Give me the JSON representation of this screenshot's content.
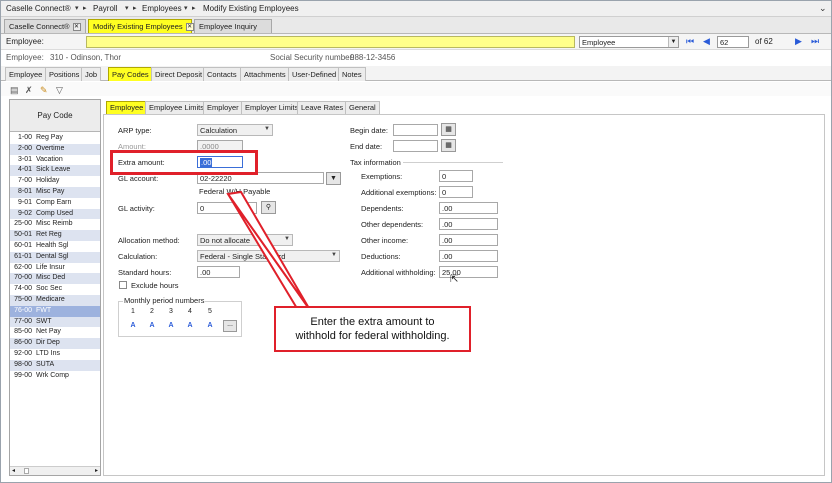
{
  "breadcrumb": [
    "Caselle Connect®",
    "Payroll",
    "Employees",
    "Modify Existing Employees"
  ],
  "doc_tabs": [
    {
      "label": "Caselle Connect®",
      "active": false
    },
    {
      "label": "Modify Existing Employees",
      "active": true
    },
    {
      "label": "Employee Inquiry",
      "active": false
    }
  ],
  "search": {
    "employee_label": "Employee:",
    "mode_value": "Employee",
    "record_number": "62",
    "record_total": "of 62"
  },
  "info": {
    "employee_label": "Employee:",
    "employee_value": "310 - Odinson, Thor",
    "ssn_label": "Social Security number:",
    "ssn_value": "988-12-3456"
  },
  "record_tabs": [
    "Employee",
    "Positions",
    "Job",
    "Pay Codes",
    "Direct Deposit",
    "Contacts",
    "Attachments",
    "User-Defined",
    "Notes"
  ],
  "pay_code_list": {
    "header": "Pay Code",
    "rows": [
      {
        "code": "1-00",
        "name": "Reg Pay"
      },
      {
        "code": "2-00",
        "name": "Overtime"
      },
      {
        "code": "3-01",
        "name": "Vacation"
      },
      {
        "code": "4-01",
        "name": "Sick Leave"
      },
      {
        "code": "7-00",
        "name": "Holiday"
      },
      {
        "code": "8-01",
        "name": "Misc Pay"
      },
      {
        "code": "9-01",
        "name": "Comp Earn"
      },
      {
        "code": "9-02",
        "name": "Comp Used"
      },
      {
        "code": "25-00",
        "name": "Misc Reimb"
      },
      {
        "code": "50-01",
        "name": "Ret Reg"
      },
      {
        "code": "60-01",
        "name": "Health Sgl"
      },
      {
        "code": "61-01",
        "name": "Dental Sgl"
      },
      {
        "code": "62-00",
        "name": "Life Insur"
      },
      {
        "code": "70-00",
        "name": "Misc Ded"
      },
      {
        "code": "74-00",
        "name": "Soc Sec"
      },
      {
        "code": "75-00",
        "name": "Medicare"
      },
      {
        "code": "76-00",
        "name": "FWT"
      },
      {
        "code": "77-00",
        "name": "SWT"
      },
      {
        "code": "85-00",
        "name": "Net Pay"
      },
      {
        "code": "86-00",
        "name": "Dir Dep"
      },
      {
        "code": "92-00",
        "name": "LTD Ins"
      },
      {
        "code": "98-00",
        "name": "SUTA"
      },
      {
        "code": "99-00",
        "name": "Wrk Comp"
      }
    ]
  },
  "form_tabs": [
    "Employee",
    "Employee Limits",
    "Employer",
    "Employer Limits",
    "Leave Rates",
    "General"
  ],
  "form": {
    "arp_type_label": "ARP type:",
    "arp_type_value": "Calculation",
    "amount_label": "Amount:",
    "amount_value": ".0000",
    "extra_amount_label": "Extra amount:",
    "extra_amount_value": ".00",
    "gl_account_label": "GL account:",
    "gl_account_value": "02-22220",
    "gl_account_desc": "Federal W/H Payable",
    "gl_activity_label": "GL activity:",
    "gl_activity_value": "0",
    "allocation_label": "Allocation method:",
    "allocation_value": "Do not allocate",
    "calculation_label": "Calculation:",
    "calculation_value": "Federal - Single Standard",
    "standard_hours_label": "Standard hours:",
    "standard_hours_value": ".00",
    "exclude_hours_label": "Exclude hours",
    "monthly_label": "Monthly period numbers",
    "monthly_nums": [
      "1",
      "2",
      "3",
      "4",
      "5"
    ],
    "monthly_vals": [
      "A",
      "A",
      "A",
      "A",
      "A"
    ],
    "more_button": "..."
  },
  "right": {
    "begin_date_label": "Begin date:",
    "end_date_label": "End date:",
    "tax_info_label": "Tax information",
    "exemptions_label": "Exemptions:",
    "exemptions_value": "0",
    "add_exemptions_label": "Additional exemptions:",
    "add_exemptions_value": "0",
    "dependents_label": "Dependents:",
    "dependents_value": ".00",
    "other_dependents_label": "Other dependents:",
    "other_dependents_value": ".00",
    "other_income_label": "Other income:",
    "other_income_value": ".00",
    "deductions_label": "Deductions:",
    "deductions_value": ".00",
    "add_withholding_label": "Additional withholding:",
    "add_withholding_value": "25.00"
  },
  "callout": {
    "line1": "Enter the extra amount to",
    "line2": "withhold for federal withholding."
  },
  "colors": {
    "highlight_yellow": "#ffff22",
    "callout_red": "#e0202a",
    "selected_row": "#9db2de",
    "alt_row": "#dde3f0",
    "link_blue": "#2a5bd8"
  }
}
